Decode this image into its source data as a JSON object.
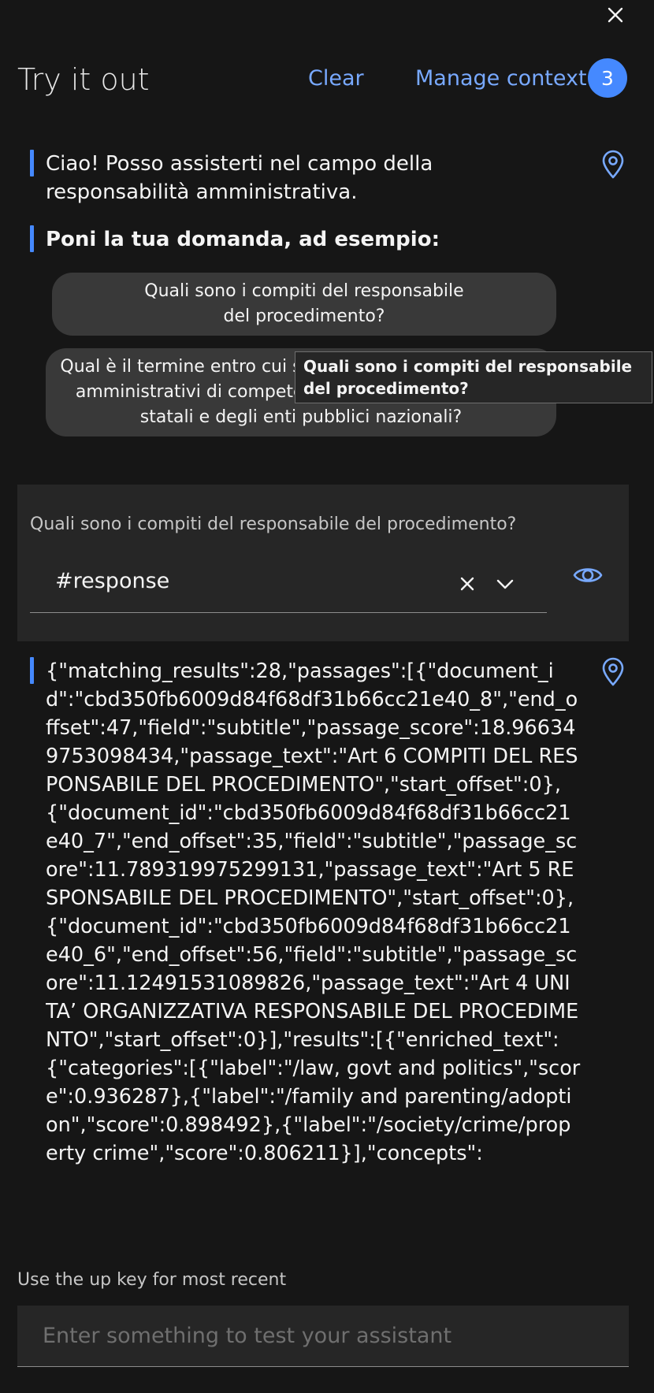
{
  "header": {
    "title": "Try it out",
    "clear_label": "Clear",
    "manage_context_label": "Manage context",
    "context_count": "3"
  },
  "greeting": {
    "text": "Ciao! Posso assisterti nel campo della responsabilità amministrativa."
  },
  "prompt": {
    "text": "Poni la tua domanda, ad esempio:"
  },
  "suggestions": [
    {
      "label": "Quali sono i compiti del responsabile del procedimento?"
    },
    {
      "label": "Qual è il termine entro cui si concludono i procedimenti amministrativi di competenza delle amministrazioni statali e degli enti pubblici nazionali?"
    }
  ],
  "tooltip": {
    "text": "Quali sono i compiti del responsabile del procedimento?"
  },
  "option_panel": {
    "question": "Quali sono i compiti del responsabile del procedimento?",
    "selected_value": "#response"
  },
  "response": {
    "text": "{\"matching_results\":28,\"passages\":[{\"document_id\":\"cbd350fb6009d84f68df31b66cc21e40_8\",\"end_offset\":47,\"field\":\"subtitle\",\"passage_score\":18.966349753098434,\"passage_text\":\"Art 6 COMPITI DEL RESPONSABILE DEL PROCEDIMENTO\",\"start_offset\":0},{\"document_id\":\"cbd350fb6009d84f68df31b66cc21e40_7\",\"end_offset\":35,\"field\":\"subtitle\",\"passage_score\":11.789319975299131,\"passage_text\":\"Art 5 RESPONSABILE DEL PROCEDIMENTO\",\"start_offset\":0},{\"document_id\":\"cbd350fb6009d84f68df31b66cc21e40_6\",\"end_offset\":56,\"field\":\"subtitle\",\"passage_score\":11.12491531089826,\"passage_text\":\"Art 4 UNITA’ ORGANIZZATIVA RESPONSABILE DEL PROCEDIMENTO\",\"start_offset\":0}],\"results\":[{\"enriched_text\":{\"categories\":[{\"label\":\"/law, govt and politics\",\"score\":0.936287},{\"label\":\"/family and parenting/adoption\",\"score\":0.898492},{\"label\":\"/society/crime/property crime\",\"score\":0.806211}],\"concepts\":"
  },
  "footer": {
    "hint": "Use the up key for most recent",
    "input_placeholder": "Enter something to test your assistant"
  },
  "colors": {
    "background": "#161616",
    "accent": "#4589ff",
    "link": "#78a9ff",
    "panel": "#262626",
    "chip": "#393939"
  },
  "icons": {
    "close": "close-icon",
    "pin": "location-pin-icon",
    "eye": "eye-icon",
    "clear": "clear-icon",
    "chevron": "chevron-down-icon"
  }
}
